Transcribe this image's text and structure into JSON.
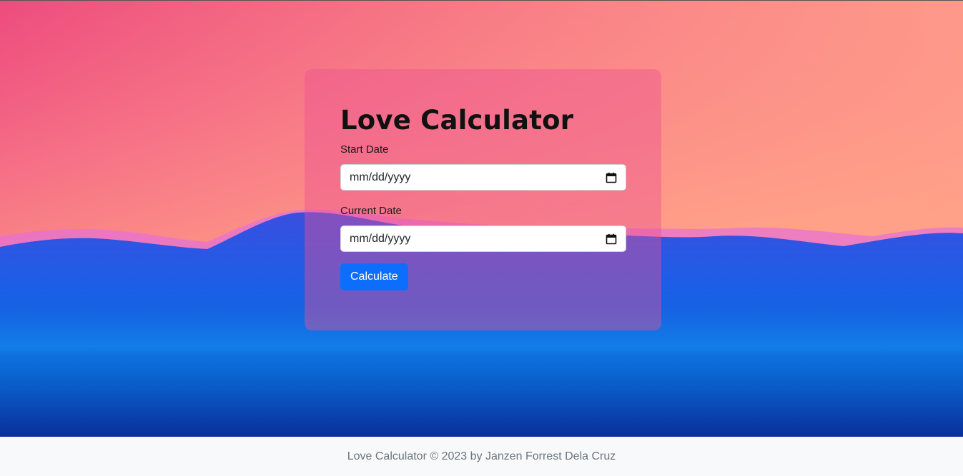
{
  "app": {
    "title": "Love Calculator"
  },
  "form": {
    "start_label": "Start Date",
    "start_placeholder": "mm/dd/yyyy",
    "current_label": "Current Date",
    "current_placeholder": "mm/dd/yyyy",
    "calendar_icon": "calendar-icon",
    "submit_label": "Calculate"
  },
  "footer": {
    "text": "Love Calculator © 2023 by Janzen Forrest Dela Cruz"
  },
  "colors": {
    "sky_top": "#e8327a",
    "sky_bottom": "#ffa085",
    "mountains": "#2a55d8",
    "primary_button": "#0d6efd",
    "footer_bg": "#f8f9fa",
    "footer_text": "#6c757d"
  }
}
